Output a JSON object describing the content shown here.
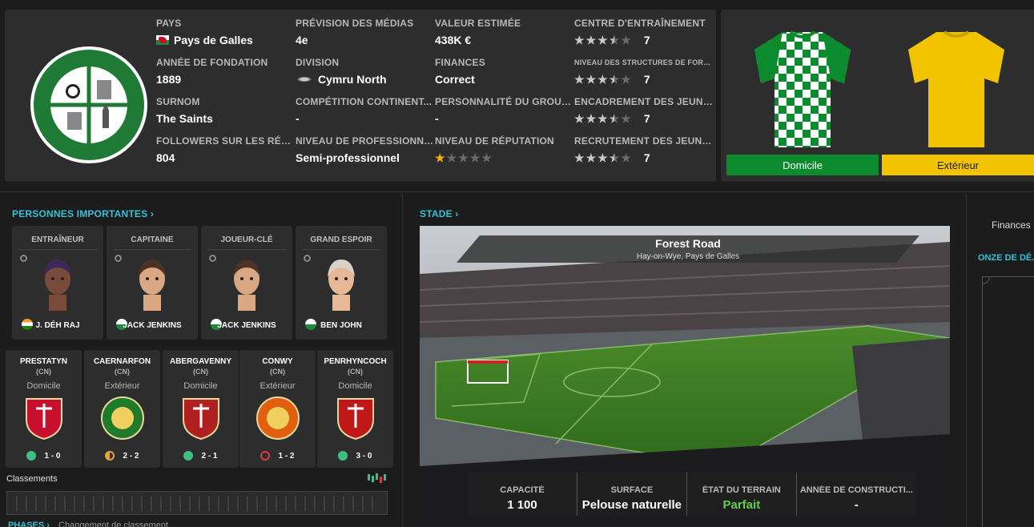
{
  "club": {
    "crest_text": "HAY ST MARY'S FOOTBALL CLUB",
    "info": [
      [
        {
          "label": "PAYS",
          "value": "Pays de Galles",
          "icon": "wales-flag"
        },
        {
          "label": "ANNÉE DE FONDATION",
          "value": "1889"
        },
        {
          "label": "SURNOM",
          "value": "The Saints"
        },
        {
          "label": "FOLLOWERS SUR LES RÉSE...",
          "value": "804"
        }
      ],
      [
        {
          "label": "PRÉVISION DES MÉDIAS",
          "value": "4e"
        },
        {
          "label": "DIVISION",
          "value": "Cymru North",
          "icon": "cymru-league-logo"
        },
        {
          "label": "COMPÉTITION CONTINENT...",
          "value": "-"
        },
        {
          "label": "NIVEAU DE PROFESSIONNAL",
          "value": "Semi-professionnel"
        }
      ],
      [
        {
          "label": "VALEUR ESTIMÉE",
          "value": "438K €"
        },
        {
          "label": "FINANCES",
          "value": "Correct"
        },
        {
          "label": "PERSONNALITÉ DU GROUPE",
          "value": "-"
        },
        {
          "label": "NIVEAU DE RÉPUTATION",
          "stars": 1,
          "max": 5
        }
      ],
      [
        {
          "label": "CENTRE D'ENTRAÎNEMENT",
          "value": "7",
          "stars": 3.5,
          "max": 5
        },
        {
          "label": "NIVEAU DES STRUCTURES DE FORMATION",
          "value": "7",
          "stars": 3.5,
          "max": 5
        },
        {
          "label": "ENCADREMENT DES JEUNES",
          "value": "7",
          "stars": 3.5,
          "max": 5
        },
        {
          "label": "RECRUTEMENT DES JEUNES",
          "value": "7",
          "stars": 3.5,
          "max": 5
        }
      ]
    ]
  },
  "kits": {
    "home_label": "Domicile",
    "away_label": "Extérieur",
    "home_color": "#0c8a2e",
    "away_color": "#f2c400"
  },
  "people": {
    "title": "PERSONNES IMPORTANTES",
    "chevron": "›",
    "items": [
      {
        "role": "ENTRAÎNEUR",
        "name": "J. DÉH RAJ",
        "flag": "indian-flag"
      },
      {
        "role": "CAPITAINE",
        "name": "JACK JENKINS",
        "flag": "wales-flag"
      },
      {
        "role": "JOUEUR-CLÉ",
        "name": "JACK JENKINS",
        "flag": "wales-flag"
      },
      {
        "role": "GRAND ESPOIR",
        "name": "BEN JOHN",
        "flag": "wales-flag"
      }
    ]
  },
  "fixtures": [
    {
      "team": "PRESTATYN",
      "comp": "(CN)",
      "venue": "Domicile",
      "score": "1 - 0",
      "status": "win",
      "badge_color": "#c8102e"
    },
    {
      "team": "CAERNARFON",
      "comp": "(CN)",
      "venue": "Extérieur",
      "score": "2 - 2",
      "status": "draw",
      "badge_color": "#1f7a2a"
    },
    {
      "team": "ABERGAVENNY",
      "comp": "(CN)",
      "venue": "Domicile",
      "score": "2 - 1",
      "status": "win",
      "badge_color": "#b02020"
    },
    {
      "team": "CONWY",
      "comp": "(CN)",
      "venue": "Extérieur",
      "score": "1 - 2",
      "status": "loss",
      "badge_color": "#e06010"
    },
    {
      "team": "PENRHYNCOCH",
      "comp": "(CN)",
      "venue": "Domicile",
      "score": "3 - 0",
      "status": "win",
      "badge_color": "#c01818"
    }
  ],
  "standings": {
    "label": "Classements",
    "phases_label": "PHASES ›",
    "phases_text": "Changement de classement..."
  },
  "stadium": {
    "title": "STADE",
    "chevron": "›",
    "name": "Forest Road",
    "location": "Hay-on-Wye, Pays de Galles",
    "stats": [
      {
        "label": "CAPACITÉ",
        "value": "1 100"
      },
      {
        "label": "SURFACE",
        "value": "Pelouse naturelle"
      },
      {
        "label": "ÉTAT DU TERRAIN",
        "value": "Parfait",
        "color": "#5fd04a"
      },
      {
        "label": "ANNÉE DE CONSTRUCTI...",
        "value": "-"
      }
    ]
  },
  "right": {
    "finances_label": "Finances",
    "onze_label": "ONZE DE DÉ..."
  },
  "colors": {
    "accent": "#36c0d8",
    "win": "#3fbf7f",
    "draw": "#e0a53a",
    "loss": "#d04040"
  }
}
